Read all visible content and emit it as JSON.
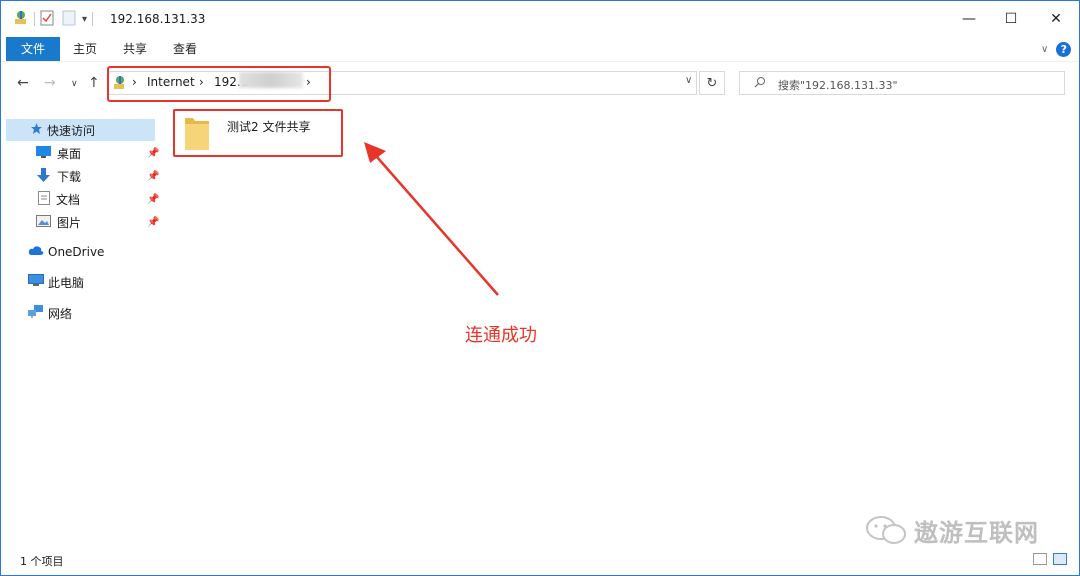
{
  "window": {
    "title": "192.168.131.33",
    "controls": {
      "minimize": "—",
      "maximize": "☐",
      "close": "✕"
    }
  },
  "ribbon": {
    "tabs": [
      "文件",
      "主页",
      "共享",
      "查看"
    ],
    "expand_glyph": "∨",
    "help_glyph": "?"
  },
  "nav": {
    "back": "←",
    "forward": "→",
    "recent": "∨",
    "up": "↑",
    "breadcrumb": [
      "Internet",
      "192.1"
    ],
    "sep": "›",
    "dropdown": "∨",
    "refresh": "↻",
    "search_placeholder": "搜索\"192.168.131.33\""
  },
  "sidebar": {
    "items": [
      {
        "label": "快速访问",
        "icon": "star-icon",
        "selected": true
      },
      {
        "label": "桌面",
        "icon": "desktop-icon",
        "pinned": true
      },
      {
        "label": "下载",
        "icon": "download-icon",
        "pinned": true
      },
      {
        "label": "文档",
        "icon": "document-icon",
        "pinned": true
      },
      {
        "label": "图片",
        "icon": "picture-icon",
        "pinned": true
      },
      {
        "label": "OneDrive",
        "icon": "cloud-icon"
      },
      {
        "label": "此电脑",
        "icon": "computer-icon"
      },
      {
        "label": "网络",
        "icon": "network-icon"
      }
    ]
  },
  "content": {
    "folder_label": "测试2 文件共享",
    "annotation": "连通成功"
  },
  "watermark": {
    "text": "遨游互联网"
  },
  "status": {
    "count": "1 个项目"
  },
  "colors": {
    "accent": "#1979ca",
    "annotation_red": "#e8352a",
    "selected_bg": "#cce4f7"
  }
}
